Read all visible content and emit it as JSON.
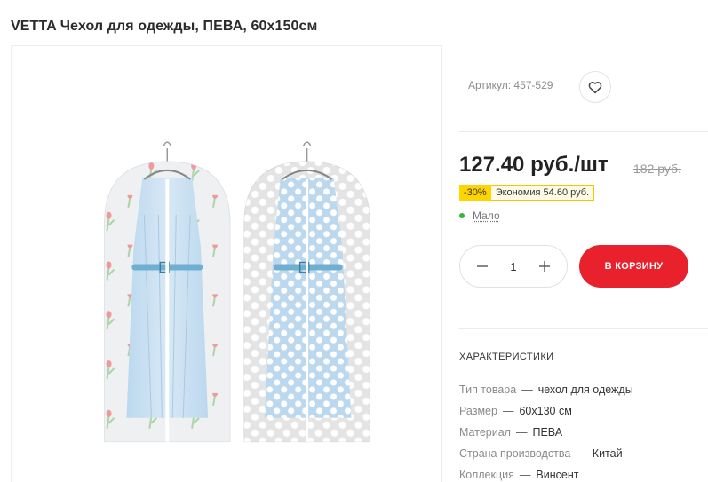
{
  "product": {
    "title": "VETTA Чехол для одежды, ПЕВА, 60x150см"
  },
  "gallery": {
    "image_alt": "Чехлы для одежды с платьями"
  },
  "info": {
    "article": "Артикул: 457-529",
    "price": "127.40 руб./шт",
    "old_price": "182 руб.",
    "discount_percent": "-30%",
    "discount_saving": "Экономия 54.60 руб.",
    "stock_status": "Мало",
    "quantity": "1",
    "cart_button_label": "В КОРЗИНУ"
  },
  "characteristics": {
    "title": "ХАРАКТЕРИСТИКИ",
    "separator": "—",
    "rows": [
      {
        "key": "Тип товара",
        "value": "чехол для одежды"
      },
      {
        "key": "Размер",
        "value": "60x130 см"
      },
      {
        "key": "Материал",
        "value": "ПЕВА"
      },
      {
        "key": "Страна производства",
        "value": "Китай"
      },
      {
        "key": "Коллекция",
        "value": "Винсент"
      }
    ]
  },
  "colors": {
    "accent_red": "#e8212c",
    "discount_yellow": "#ffd400",
    "stock_green": "#34b634",
    "dress_blue": "#bcd8ee"
  },
  "icons": {
    "favorite": "heart-icon",
    "decrease": "minus-icon",
    "increase": "plus-icon",
    "stock": "status-dot-icon"
  }
}
